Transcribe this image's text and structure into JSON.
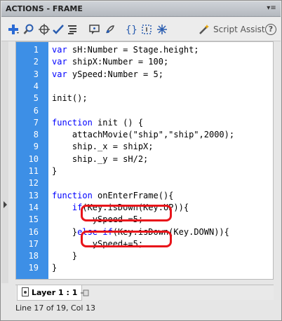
{
  "window": {
    "title": "ACTIONS - FRAME"
  },
  "toolbar": {
    "buttons": [
      "add-script-item-icon",
      "find-icon",
      "insert-target-path-icon",
      "check-syntax-icon",
      "auto-format-icon",
      "show-code-hint-icon",
      "debug-options-icon",
      "collapse-between-braces-icon",
      "collapse-selection-icon",
      "expand-all-icon"
    ],
    "script_assist_label": "Script Assist",
    "help_label": "?"
  },
  "editor": {
    "lines": [
      {
        "num": "1",
        "text": "var sH:Number = Stage.height;"
      },
      {
        "num": "2",
        "text": "var shipX:Number = 100;"
      },
      {
        "num": "3",
        "text": "var ySpeed:Number = 5;"
      },
      {
        "num": "4",
        "text": ""
      },
      {
        "num": "5",
        "text": "init();"
      },
      {
        "num": "6",
        "text": ""
      },
      {
        "num": "7",
        "text": "function init () {"
      },
      {
        "num": "8",
        "text": "    attachMovie(\"ship\",\"ship\",2000);"
      },
      {
        "num": "9",
        "text": "    ship._x = shipX;"
      },
      {
        "num": "10",
        "text": "    ship._y = sH/2;"
      },
      {
        "num": "11",
        "text": "}"
      },
      {
        "num": "12",
        "text": ""
      },
      {
        "num": "13",
        "text": "function onEnterFrame(){"
      },
      {
        "num": "14",
        "text": "    if(Key.isDown(Key.UP)){"
      },
      {
        "num": "15",
        "text": "        ySpeed-=5;"
      },
      {
        "num": "16",
        "text": "    }else if(Key.isDown(Key.DOWN)){"
      },
      {
        "num": "17",
        "text": "        ySpeed+=5;"
      },
      {
        "num": "18",
        "text": "    }"
      },
      {
        "num": "19",
        "text": "}"
      }
    ],
    "highlight_color": "#e8141a",
    "gutter_color": "#3d8fe6"
  },
  "tabs": {
    "layer_label": "Layer 1 : 1"
  },
  "status": {
    "text": "Line 17 of 19, Col 13"
  }
}
